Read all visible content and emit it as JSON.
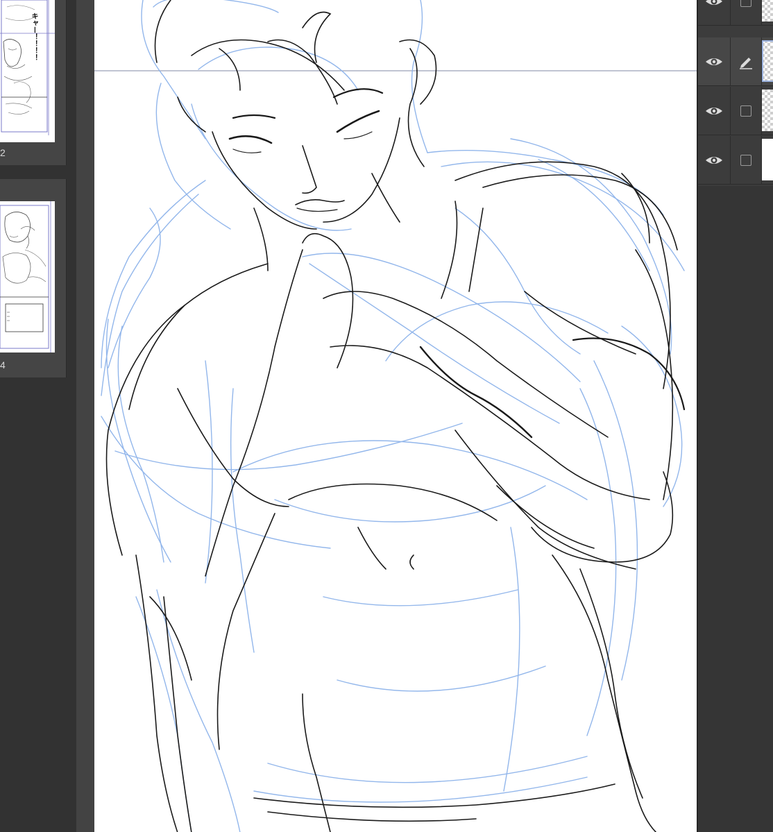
{
  "page_panel": {
    "pages": [
      {
        "number": "2",
        "heading": "キャー！！！！",
        "state": "upper"
      },
      {
        "number": "4",
        "heading": "",
        "state": "lower"
      }
    ]
  },
  "layers": {
    "rows": [
      {
        "visible": true,
        "locked": false,
        "editing": false,
        "thumb": "transparent"
      },
      {
        "visible": true,
        "locked": false,
        "editing": true,
        "thumb": "transparent"
      },
      {
        "visible": true,
        "locked": false,
        "editing": false,
        "thumb": "transparent"
      },
      {
        "visible": true,
        "locked": false,
        "editing": false,
        "thumb": "white"
      }
    ]
  },
  "colors": {
    "lineart": "#1a1a1a",
    "rough_sketch": "#8db3ea",
    "guide_line": "#9aa0b8",
    "ui_dark": "#3a3a3a"
  },
  "icons": {
    "visibility": "eye-icon",
    "edit": "pencil-icon",
    "lock": "checkbox-icon"
  }
}
